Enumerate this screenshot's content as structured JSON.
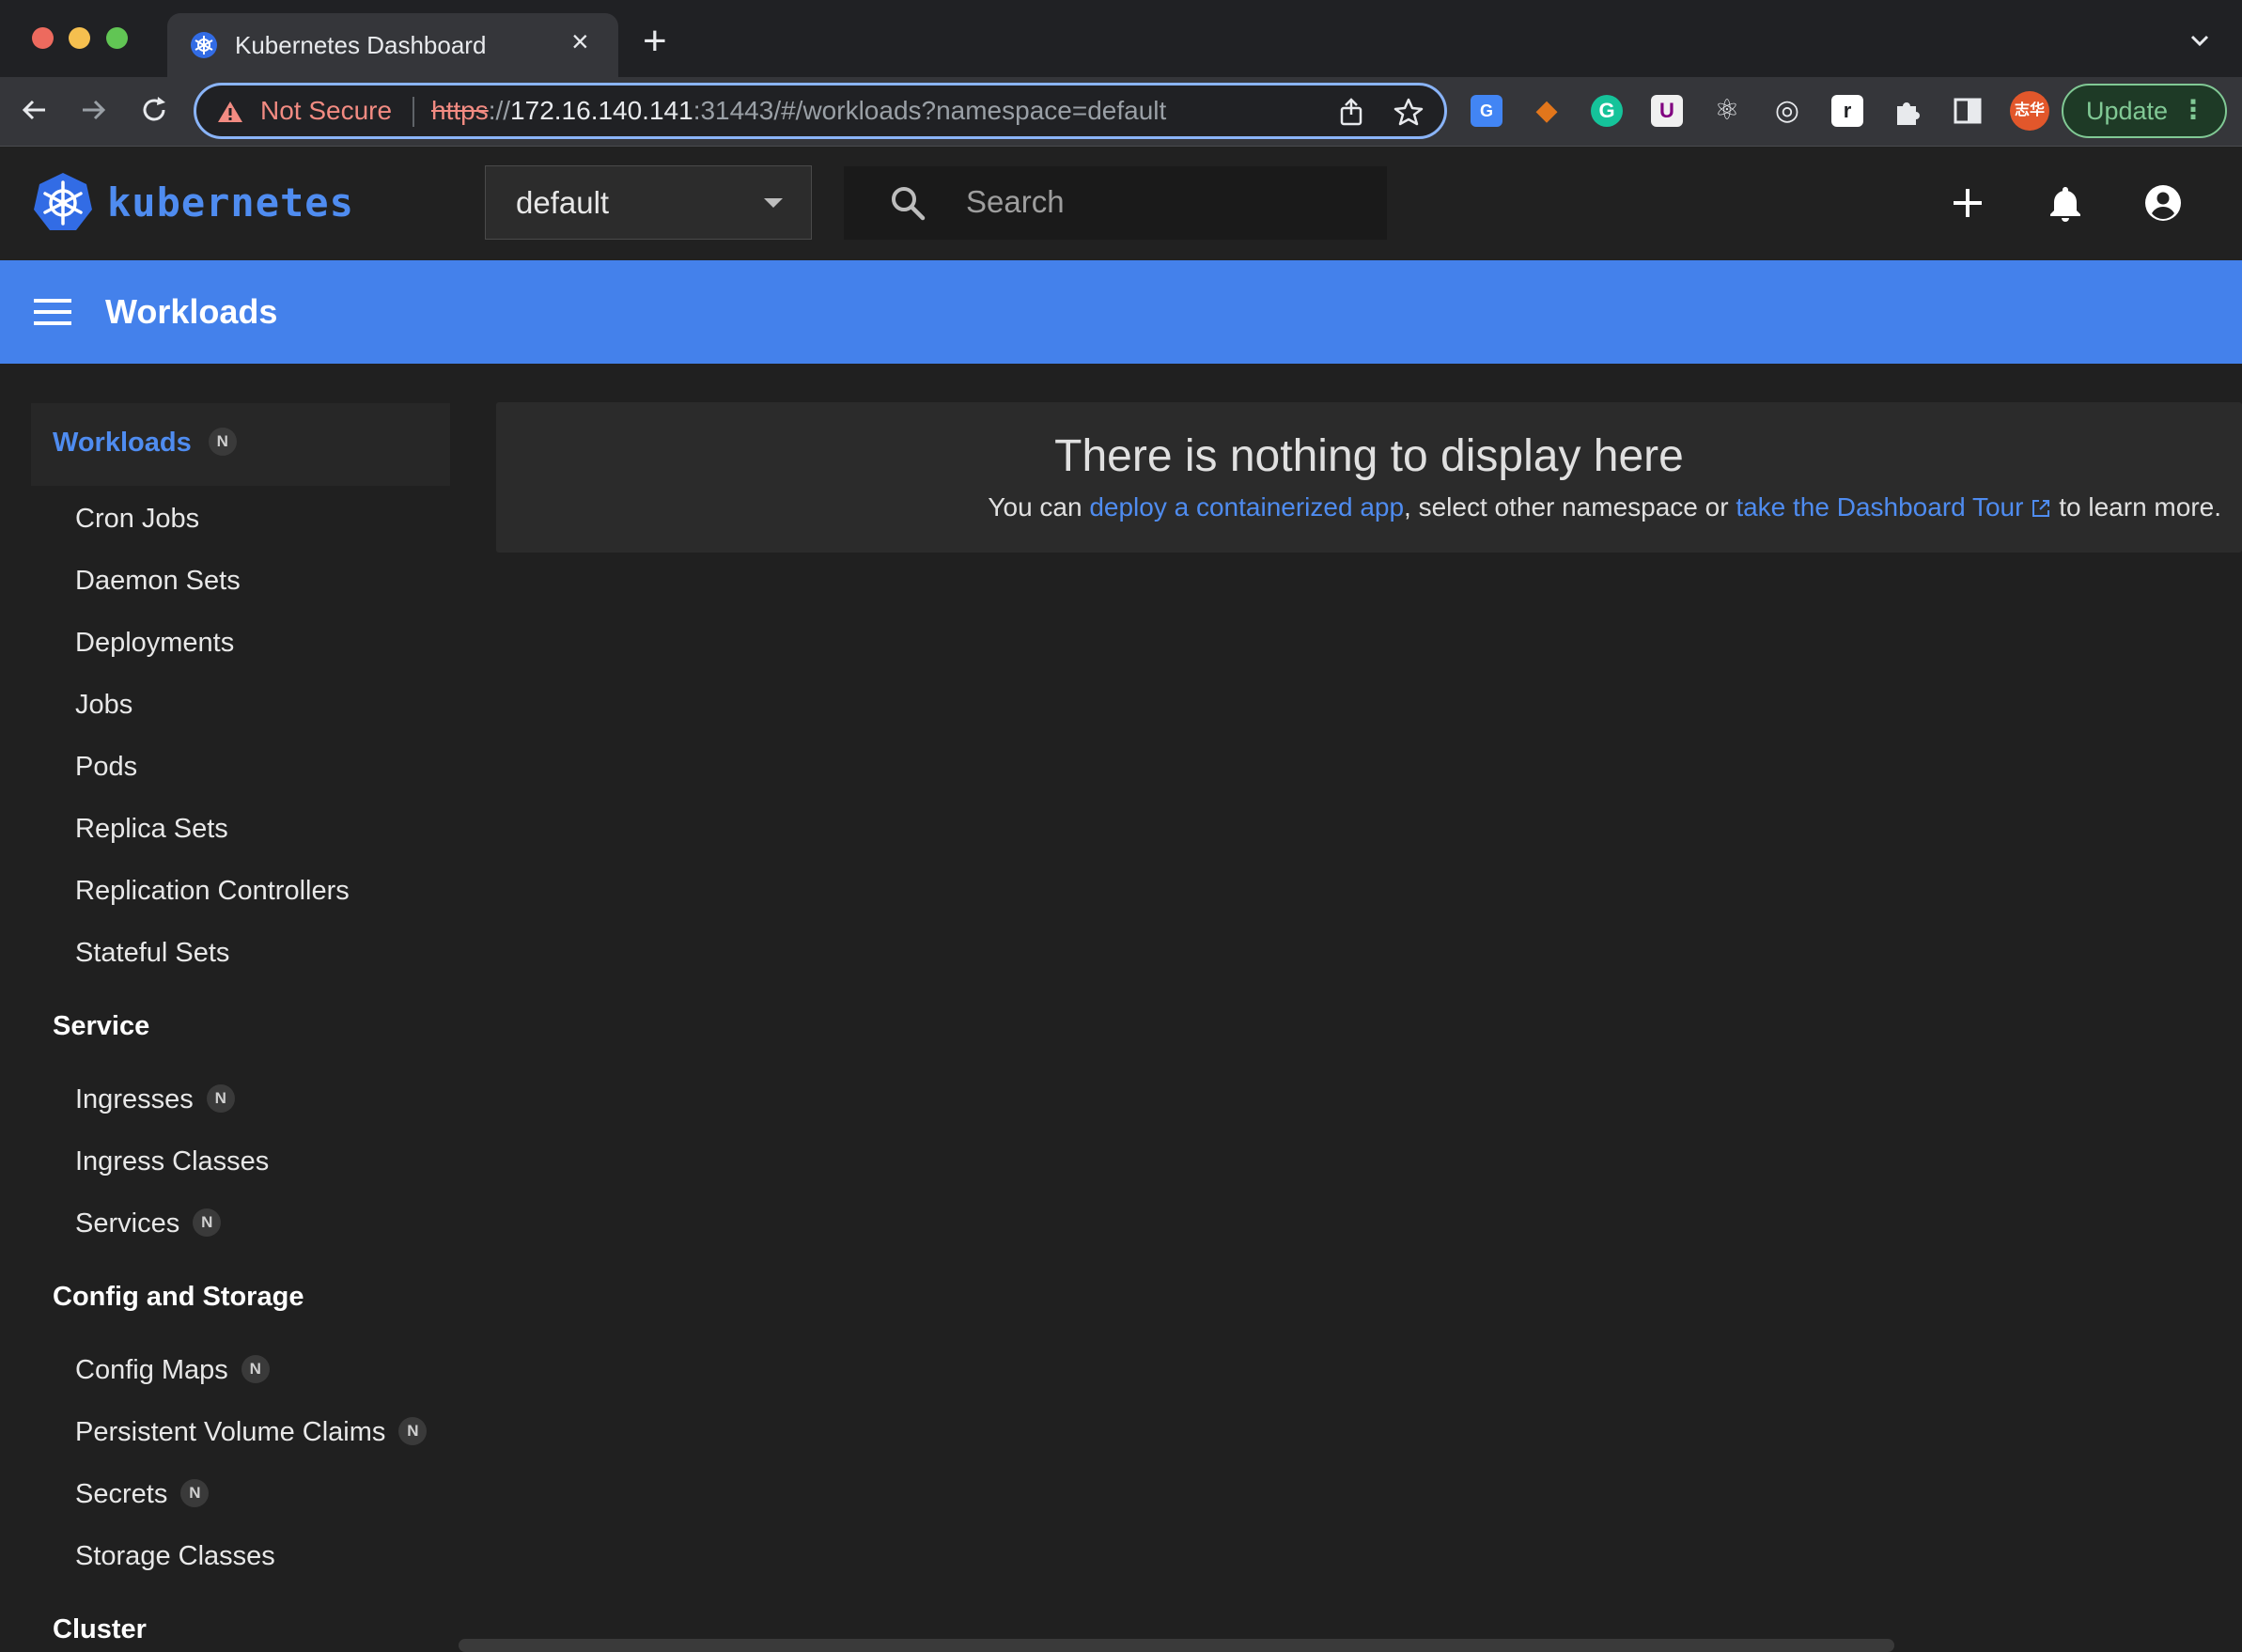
{
  "browser": {
    "tab_title": "Kubernetes Dashboard",
    "new_tab": "+",
    "close_tab": "×",
    "security_label": "Not Secure",
    "url": {
      "scheme": "https",
      "sep": "://",
      "host": "172.16.140.141",
      "path": ":31443/#/workloads?namespace=default"
    },
    "update_label": "Update",
    "ext_icons": [
      "google-translate-icon",
      "metamask-icon",
      "grammarly-icon",
      "ublock-icon",
      "react-devtools-icon",
      "target-icon",
      "readwise-icon",
      "extensions-puzzle-icon",
      "sidepanel-icon",
      "profile-avatar-icon"
    ]
  },
  "header": {
    "logo_text": "kubernetes",
    "namespace_value": "default",
    "search_placeholder": "Search"
  },
  "pagebar": {
    "title": "Workloads"
  },
  "sidebar": {
    "active": {
      "label": "Workloads",
      "badge": "N"
    },
    "workloads": [
      "Cron Jobs",
      "Daemon Sets",
      "Deployments",
      "Jobs",
      "Pods",
      "Replica Sets",
      "Replication Controllers",
      "Stateful Sets"
    ],
    "service": {
      "title": "Service",
      "items": [
        {
          "label": "Ingresses",
          "badge": "N"
        },
        {
          "label": "Ingress Classes",
          "badge": ""
        },
        {
          "label": "Services",
          "badge": "N"
        }
      ]
    },
    "config": {
      "title": "Config and Storage",
      "items": [
        {
          "label": "Config Maps",
          "badge": "N"
        },
        {
          "label": "Persistent Volume Claims",
          "badge": "N"
        },
        {
          "label": "Secrets",
          "badge": "N"
        },
        {
          "label": "Storage Classes",
          "badge": ""
        }
      ]
    },
    "cluster": {
      "title": "Cluster"
    }
  },
  "main": {
    "empty_title": "There is nothing to display here",
    "text_1": "You can ",
    "link_1": "deploy a containerized app",
    "text_2": ", select other namespace or ",
    "link_2": "take the Dashboard Tour",
    "text_3": " to learn more."
  },
  "colors": {
    "accent": "#4481eb",
    "link": "#4f8cf0",
    "warning": "#f28b82"
  }
}
